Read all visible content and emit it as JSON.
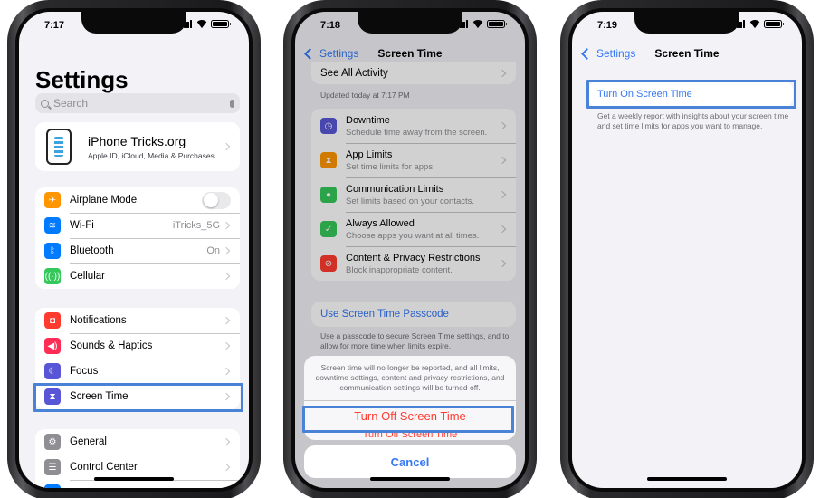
{
  "phone1": {
    "time": "7:17",
    "title": "Settings",
    "search_placeholder": "Search",
    "account": {
      "name": "iPhone Tricks.org",
      "subtitle": "Apple ID, iCloud, Media & Purchases"
    },
    "group1": [
      {
        "label": "Airplane Mode",
        "value": "",
        "icon": "airplane-icon",
        "color": "#ff9500",
        "toggle": true
      },
      {
        "label": "Wi-Fi",
        "value": "iTricks_5G",
        "icon": "wifi-icon",
        "color": "#007aff"
      },
      {
        "label": "Bluetooth",
        "value": "On",
        "icon": "bluetooth-icon",
        "color": "#007aff"
      },
      {
        "label": "Cellular",
        "value": "",
        "icon": "cellular-icon",
        "color": "#34c759"
      }
    ],
    "group2": [
      {
        "label": "Notifications",
        "icon": "bell-icon",
        "color": "#ff3b30"
      },
      {
        "label": "Sounds & Haptics",
        "icon": "speaker-icon",
        "color": "#ff2d55"
      },
      {
        "label": "Focus",
        "icon": "moon-icon",
        "color": "#5856d6"
      },
      {
        "label": "Screen Time",
        "icon": "hourglass-icon",
        "color": "#5856d6"
      }
    ],
    "group3": [
      {
        "label": "General",
        "icon": "gear-icon",
        "color": "#8e8e93"
      },
      {
        "label": "Control Center",
        "icon": "switches-icon",
        "color": "#8e8e93"
      }
    ]
  },
  "phone2": {
    "time": "7:18",
    "back": "Settings",
    "title": "Screen Time",
    "see_all": "See All Activity",
    "updated": "Updated today at 7:17 PM",
    "items": [
      {
        "title": "Downtime",
        "sub": "Schedule time away from the screen.",
        "icon": "downtime-icon",
        "color": "#5856d6"
      },
      {
        "title": "App Limits",
        "sub": "Set time limits for apps.",
        "icon": "hourglass-icon",
        "color": "#ff9500"
      },
      {
        "title": "Communication Limits",
        "sub": "Set limits based on your contacts.",
        "icon": "person-icon",
        "color": "#34c759"
      },
      {
        "title": "Always Allowed",
        "sub": "Choose apps you want at all times.",
        "icon": "checkmark-icon",
        "color": "#34c759"
      },
      {
        "title": "Content & Privacy Restrictions",
        "sub": "Block inappropriate content.",
        "icon": "restriction-icon",
        "color": "#ff3b30"
      }
    ],
    "passcode": "Use Screen Time Passcode",
    "passcode_note": "Use a passcode to secure Screen Time settings, and to allow for more time when limits expire.",
    "sheet_message": "Screen time will no longer be reported, and all limits, downtime settings, content and privacy restrictions, and communication settings will be turned off.",
    "turn_off": "Turn Off Screen Time",
    "cancel": "Cancel"
  },
  "phone3": {
    "time": "7:19",
    "back": "Settings",
    "title": "Screen Time",
    "turn_on": "Turn On Screen Time",
    "note": "Get a weekly report with insights about your screen time and set time limits for apps you want to manage."
  }
}
